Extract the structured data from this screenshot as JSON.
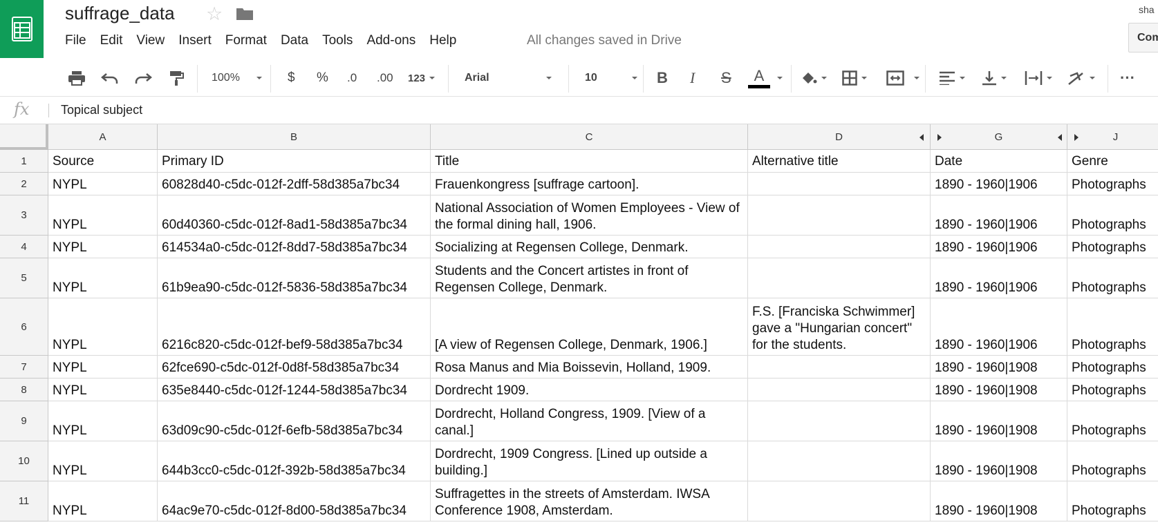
{
  "app": {
    "logo": "sheets-logo-icon",
    "doc_title": "suffrage_data",
    "user_email": "sha",
    "comments_label": "Comments",
    "save_status": "All changes saved in Drive",
    "accent_color": "#0f9d58"
  },
  "menu": [
    "File",
    "Edit",
    "View",
    "Insert",
    "Format",
    "Data",
    "Tools",
    "Add-ons",
    "Help"
  ],
  "toolbar": {
    "zoom": "100%",
    "currency": "$",
    "percent": "%",
    "decrease_decimal": ".0",
    "increase_decimal": ".00",
    "more_formats": "123",
    "font": "Arial",
    "font_size": "10",
    "bold": "B",
    "italic": "I",
    "strikethrough": "S",
    "text_color": "A",
    "more": "···"
  },
  "formula_bar": {
    "fx": "fx",
    "value": "Topical subject"
  },
  "columns": [
    "A",
    "B",
    "C",
    "D",
    "G",
    "J"
  ],
  "rows": [
    {
      "num": "1",
      "cells": [
        "Source",
        "Primary ID",
        "Title",
        "Alternative title",
        "Date",
        "Genre"
      ]
    },
    {
      "num": "2",
      "cells": [
        "NYPL",
        "60828d40-c5dc-012f-2dff-58d385a7bc34",
        "Frauenkongress [suffrage cartoon].",
        "",
        "1890 - 1960|1906",
        "Photographs"
      ]
    },
    {
      "num": "3",
      "cells": [
        "NYPL",
        "60d40360-c5dc-012f-8ad1-58d385a7bc34",
        "National Association of Women Employees - View of the  formal dining hall, 1906.",
        "",
        "1890 - 1960|1906",
        "Photographs"
      ]
    },
    {
      "num": "4",
      "cells": [
        "NYPL",
        "614534a0-c5dc-012f-8dd7-58d385a7bc34",
        "Socializing at Regensen College, Denmark.",
        "",
        "1890 - 1960|1906",
        "Photographs"
      ]
    },
    {
      "num": "5",
      "cells": [
        "NYPL",
        "61b9ea90-c5dc-012f-5836-58d385a7bc34",
        "Students and the Concert artistes in front of Regensen College, Denmark.",
        "",
        "1890 - 1960|1906",
        "Photographs"
      ]
    },
    {
      "num": "6",
      "cells": [
        "NYPL",
        "6216c820-c5dc-012f-bef9-58d385a7bc34",
        "[A view of Regensen College, Denmark, 1906.]",
        "F.S. [Franciska Schwimmer] gave a \"Hungarian concert\" for the students.",
        "1890 - 1960|1906",
        "Photographs"
      ]
    },
    {
      "num": "7",
      "cells": [
        "NYPL",
        "62fce690-c5dc-012f-0d8f-58d385a7bc34",
        "Rosa Manus and Mia Boissevin, Holland, 1909.",
        "",
        "1890 - 1960|1908",
        "Photographs"
      ]
    },
    {
      "num": "8",
      "cells": [
        "NYPL",
        "635e8440-c5dc-012f-1244-58d385a7bc34",
        "Dordrecht 1909.",
        "",
        "1890 - 1960|1908",
        "Photographs"
      ]
    },
    {
      "num": "9",
      "cells": [
        "NYPL",
        "63d09c90-c5dc-012f-6efb-58d385a7bc34",
        "Dordrecht, Holland Congress, 1909. [View of a canal.]",
        "",
        "1890 - 1960|1908",
        "Photographs"
      ]
    },
    {
      "num": "10",
      "cells": [
        "NYPL",
        "644b3cc0-c5dc-012f-392b-58d385a7bc34",
        "Dordrecht, 1909 Congress. [Lined up outside a building.]",
        "",
        "1890 - 1960|1908",
        "Photographs"
      ]
    },
    {
      "num": "11",
      "cells": [
        "NYPL",
        "64ac9e70-c5dc-012f-8d00-58d385a7bc34",
        "Suffragettes in the streets of Amsterdam. IWSA Conference 1908, Amsterdam.",
        "",
        "1890 - 1960|1908",
        "Photographs"
      ]
    }
  ]
}
